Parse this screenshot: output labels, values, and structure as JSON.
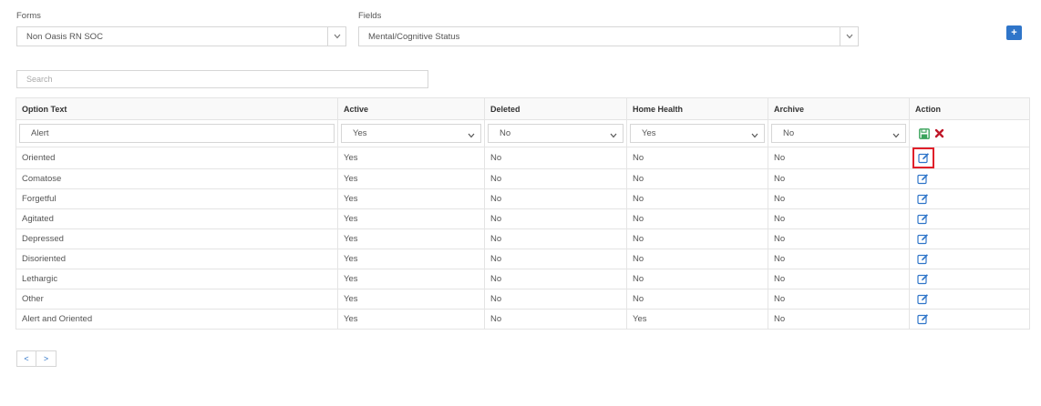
{
  "forms": {
    "label": "Forms",
    "value": "Non Oasis RN SOC"
  },
  "fields": {
    "label": "Fields",
    "value": "Mental/Cognitive Status"
  },
  "add_button": "+",
  "search": {
    "placeholder": "Search"
  },
  "table": {
    "headers": [
      "Option Text",
      "Active",
      "Deleted",
      "Home Health",
      "Archive",
      "Action"
    ],
    "filter": {
      "option_text": "Alert",
      "active": "Yes",
      "deleted": "No",
      "home_health": "Yes",
      "archive": "No"
    },
    "rows": [
      [
        "Oriented",
        "Yes",
        "No",
        "No",
        "No"
      ],
      [
        "Comatose",
        "Yes",
        "No",
        "No",
        "No"
      ],
      [
        "Forgetful",
        "Yes",
        "No",
        "No",
        "No"
      ],
      [
        "Agitated",
        "Yes",
        "No",
        "No",
        "No"
      ],
      [
        "Depressed",
        "Yes",
        "No",
        "No",
        "No"
      ],
      [
        "Disoriented",
        "Yes",
        "No",
        "No",
        "No"
      ],
      [
        "Lethargic",
        "Yes",
        "No",
        "No",
        "No"
      ],
      [
        "Other",
        "Yes",
        "No",
        "No",
        "No"
      ],
      [
        "Alert and Oriented",
        "Yes",
        "No",
        "Yes",
        "No"
      ]
    ]
  },
  "pager": {
    "prev": "<",
    "next": ">"
  },
  "colors": {
    "accent": "#2f75c9",
    "highlight": "#e0202a",
    "save": "#3aa35b",
    "delete": "#c0182a"
  },
  "icons": {
    "edit": "edit-icon",
    "save": "save-icon",
    "cancel": "close-icon",
    "dropdown": "chevron-down-icon"
  }
}
